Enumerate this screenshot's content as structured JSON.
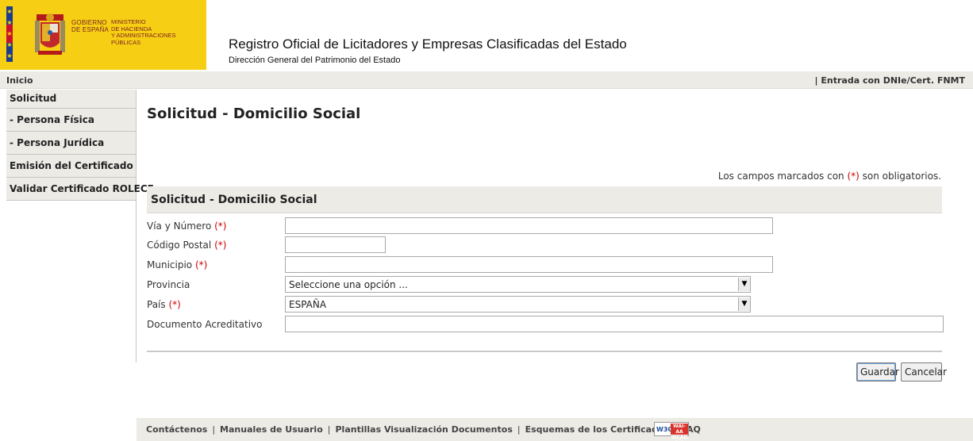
{
  "header": {
    "gov_line1": "GOBIERNO",
    "gov_line2": "DE ESPAÑA",
    "ministry_line1": "MINISTERIO",
    "ministry_line2": "DE HACIENDA",
    "ministry_line3": "Y ADMINISTRACIONES PÚBLICAS",
    "title": "Registro Oficial de Licitadores y Empresas Clasificadas del Estado",
    "subtitle": "Dirección General del Patrimonio del Estado"
  },
  "topbar": {
    "home": "Inicio",
    "login": "| Entrada con DNIe/Cert. FNMT"
  },
  "sidebar": {
    "items": [
      {
        "label": "Solicitud"
      },
      {
        "label": " - Persona Física"
      },
      {
        "label": " - Persona Jurídica"
      },
      {
        "label": "Emisión del Certificado"
      },
      {
        "label": "Validar Certificado ROLECE"
      }
    ]
  },
  "main": {
    "heading": "Solicitud - Domicilio Social",
    "required_note_prefix": "Los campos marcados con ",
    "required_marker": "(*)",
    "required_note_suffix": " son obligatorios.",
    "form_title": "Solicitud - Domicilio Social",
    "fields": {
      "via": {
        "label": "Vía y Número ",
        "required": "(*)",
        "value": ""
      },
      "cp": {
        "label": "Código Postal ",
        "required": "(*)",
        "value": ""
      },
      "municipio": {
        "label": "Municipio ",
        "required": "(*)",
        "value": ""
      },
      "provincia": {
        "label": "Provincia",
        "value": "Seleccione una opción ..."
      },
      "pais": {
        "label": "País ",
        "required": "(*)",
        "value": "ESPAÑA"
      },
      "documento": {
        "label": "Documento Acreditativo",
        "value": ""
      }
    },
    "buttons": {
      "save": "Guardar",
      "cancel": "Cancelar"
    }
  },
  "footer": {
    "links": [
      "Contáctenos",
      "Manuales de Usuario",
      "Plantillas Visualización Documentos",
      "Esquemas de los Certificados",
      "FAQ"
    ],
    "separators": [
      "|",
      "|",
      "|",
      "|"
    ],
    "badge_w3c": "W3C",
    "badge_top": "WAI-AA",
    "badge_bottom": "WCAG 1.0"
  },
  "colors": {
    "gov_yellow": "#f6cf15",
    "bar_grey": "#ecebe6",
    "required_red": "#cc0000"
  }
}
